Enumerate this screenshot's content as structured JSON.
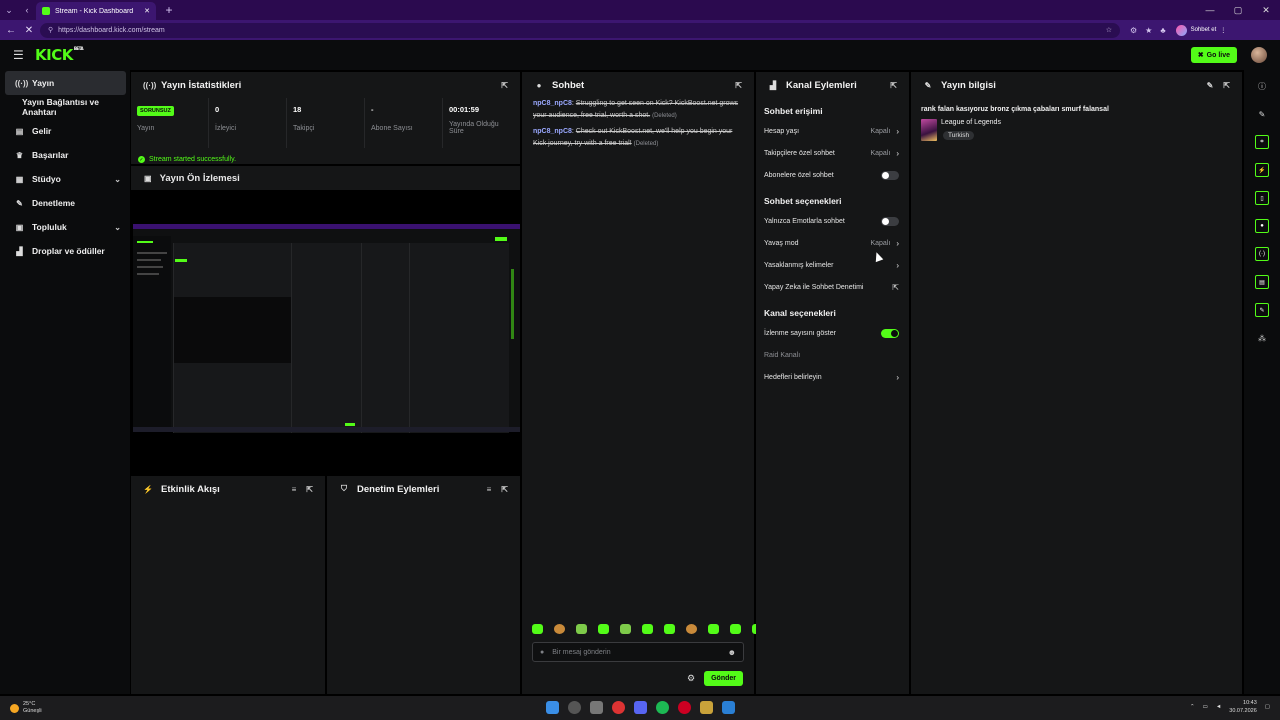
{
  "browser": {
    "tab_title": "Stream - Kick Dashboard",
    "new_tab": "+",
    "url": "https://dashboard.kick.com/stream",
    "profile_label": "Sohbet et"
  },
  "app": {
    "logo": "KICK",
    "logo_beta": "BETA",
    "go_live": "Go live"
  },
  "sidebar": {
    "items": [
      {
        "label": "Yayın",
        "icon": "broadcast-icon"
      },
      {
        "label": "Yayın Bağlantısı ve Anahtarı",
        "icon": ""
      },
      {
        "label": "Gelir",
        "icon": "revenue-icon"
      },
      {
        "label": "Başarılar",
        "icon": "trophy-icon"
      },
      {
        "label": "Stüdyo",
        "icon": "studio-icon"
      },
      {
        "label": "Denetleme",
        "icon": "wrench-icon"
      },
      {
        "label": "Topluluk",
        "icon": "community-icon"
      },
      {
        "label": "Droplar ve ödüller",
        "icon": "gift-icon"
      }
    ]
  },
  "stats": {
    "title": "Yayın İstatistikleri",
    "badge": "SORUNSUZ",
    "items": [
      {
        "value": "",
        "label": "Yayın"
      },
      {
        "value": "0",
        "label": "İzleyici"
      },
      {
        "value": "18",
        "label": "Takipçi"
      },
      {
        "value": "-",
        "label": "Abone Sayısı"
      },
      {
        "value": "00:01:59",
        "label": "Yayında Olduğu Süre"
      }
    ],
    "started_msg": "Stream started successfully."
  },
  "preview": {
    "title": "Yayın Ön İzlemesi"
  },
  "activity": {
    "title": "Etkinlik Akışı"
  },
  "modactions": {
    "title": "Denetim Eylemleri"
  },
  "chat": {
    "title": "Sohbet",
    "messages": [
      {
        "user": "npC8_npC8",
        "text": "Struggling to get seen on Kick? KickBoost.net grows your audience, free trial, worth a shot.",
        "deleted": "(Deleted)"
      },
      {
        "user": "npC8_npC8",
        "text": "Check out KickBoost.net, we'll help you begin your Kick journey, try with a free trial!",
        "deleted": "(Deleted)"
      }
    ],
    "placeholder": "Bir mesaj gönderin",
    "send": "Gönder"
  },
  "channel": {
    "title": "Kanal Eylemleri",
    "sections": [
      {
        "title": "Sohbet erişimi",
        "options": [
          {
            "label": "Hesap yaşı",
            "value": "Kapalı",
            "control": "chevron"
          },
          {
            "label": "Takipçilere özel sohbet",
            "value": "Kapalı",
            "control": "chevron"
          },
          {
            "label": "Abonelere özel sohbet",
            "value": "",
            "control": "toggle-off"
          }
        ]
      },
      {
        "title": "Sohbet seçenekleri",
        "options": [
          {
            "label": "Yalnızca Emotlarla sohbet",
            "value": "",
            "control": "toggle-off"
          },
          {
            "label": "Yavaş mod",
            "value": "Kapalı",
            "control": "chevron"
          },
          {
            "label": "Yasaklanmış kelimeler",
            "value": "",
            "control": "chevron"
          },
          {
            "label": "Yapay Zeka ile Sohbet Denetimi",
            "value": "",
            "control": "external"
          }
        ]
      },
      {
        "title": "Kanal seçenekleri",
        "options": [
          {
            "label": "İzlenme sayısını göster",
            "value": "",
            "control": "toggle-on"
          },
          {
            "label": "Raid Kanalı",
            "value": "",
            "control": "none"
          },
          {
            "label": "Hedefleri belirleyin",
            "value": "",
            "control": "chevron"
          }
        ]
      }
    ]
  },
  "info": {
    "title": "Yayın bilgisi",
    "stream_title": "rank falan kasıyoruz bronz çıkma çabaları smurf falansal",
    "category": "League of Legends",
    "language": "Turkish"
  },
  "taskbar": {
    "temp": "25°C",
    "weather": "Güneşli",
    "time": "10:43",
    "date": "30.07.2026"
  },
  "colors": {
    "accent": "#53fc18",
    "panel": "#151617",
    "chrome": "#3c1670"
  }
}
